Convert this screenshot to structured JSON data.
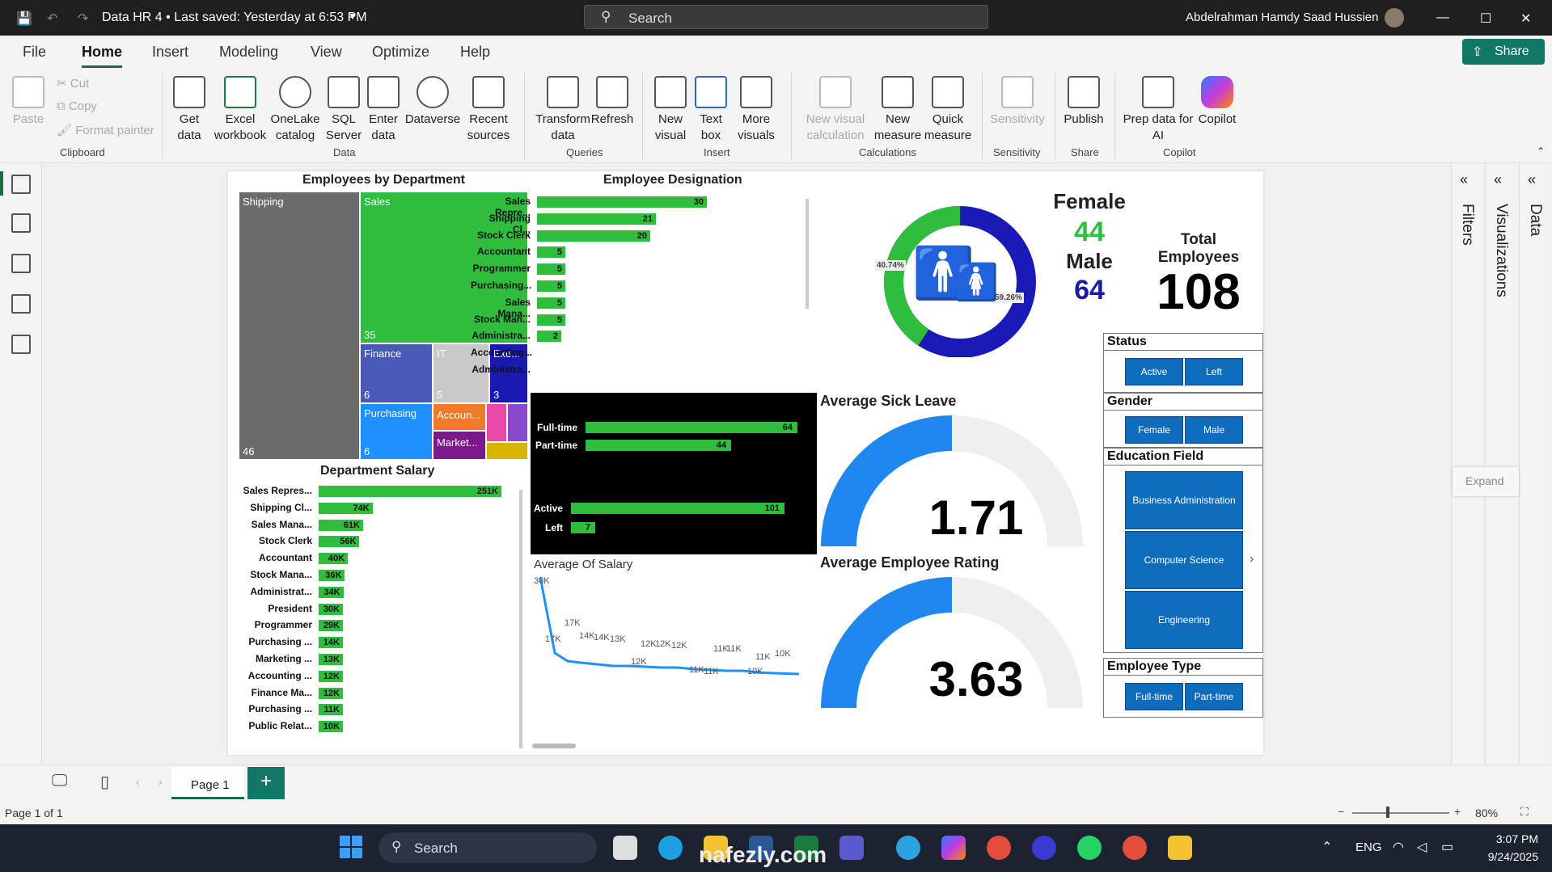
{
  "window": {
    "title": "Data HR 4 • Last saved: Yesterday at 6:53 PM",
    "search_placeholder": "Search",
    "user": "Abdelrahman Hamdy Saad Hussien"
  },
  "menu": {
    "items": [
      "File",
      "Home",
      "Insert",
      "Modeling",
      "View",
      "Optimize",
      "Help"
    ],
    "active": "Home",
    "share_label": "Share"
  },
  "ribbon": {
    "clipboard": {
      "paste": "Paste",
      "cut": "Cut",
      "copy": "Copy",
      "format_painter": "Format painter",
      "group": "Clipboard"
    },
    "data": {
      "group": "Data",
      "buttons": [
        "Get data",
        "Excel workbook",
        "OneLake catalog",
        "SQL Server",
        "Enter data",
        "Dataverse",
        "Recent sources"
      ]
    },
    "queries": {
      "group": "Queries",
      "buttons": [
        "Transform data",
        "Refresh"
      ]
    },
    "insert": {
      "group": "Insert",
      "buttons": [
        "New visual",
        "Text box",
        "More visuals"
      ]
    },
    "calculations": {
      "group": "Calculations",
      "buttons": [
        "New visual calculation",
        "New measure",
        "Quick measure"
      ]
    },
    "sensitivity": {
      "group": "Sensitivity",
      "buttons": [
        "Sensitivity"
      ]
    },
    "share": {
      "group": "Share",
      "buttons": [
        "Publish"
      ]
    },
    "copilot": {
      "group": "Copilot",
      "buttons": [
        "Prep data for AI",
        "Copilot"
      ]
    }
  },
  "panes": {
    "filters": "Filters",
    "visualizations": "Visualizations",
    "data": "Data",
    "expand": "Expand"
  },
  "report": {
    "treemap": {
      "title": "Employees by Department",
      "items": [
        {
          "name": "Shipping",
          "value": "46",
          "color": "#6b6b6b"
        },
        {
          "name": "Sales",
          "value": "35",
          "color": "#2ebd3c"
        },
        {
          "name": "Finance",
          "value": "6",
          "color": "#4a5ab8"
        },
        {
          "name": "IT",
          "value": "5",
          "color": "#c8c8c8"
        },
        {
          "name": "Exe...",
          "value": "3",
          "color": "#1a1ab0"
        },
        {
          "name": "Purchasing",
          "value": "6",
          "color": "#1e90ff"
        },
        {
          "name": "Accoun...",
          "value": "",
          "color": "#f07a2a"
        },
        {
          "name": "Market...",
          "value": "",
          "color": "#7a1a8a"
        }
      ]
    },
    "designation": {
      "title": "Employee Designation",
      "labels": [
        "Sales Repre...",
        "Shipping Cl...",
        "Stock Clerk",
        "Accountant",
        "Programmer",
        "Purchasing...",
        "Sales Mana...",
        "Stock Man...",
        "Administra...",
        "Accounting...",
        "Administra..."
      ],
      "values": [
        "30",
        "21",
        "20",
        "5",
        "5",
        "5",
        "5",
        "5",
        "2",
        "",
        ""
      ],
      "nums": [
        30,
        21,
        20,
        5,
        5,
        5,
        5,
        5,
        2,
        0,
        0
      ]
    },
    "dept_salary": {
      "title": "Department Salary",
      "labels": [
        "Sales Repres...",
        "Shipping Cl...",
        "Sales Mana...",
        "Stock Clerk",
        "Accountant",
        "Stock Mana...",
        "Administrat...",
        "President",
        "Programmer",
        "Purchasing ...",
        "Marketing ...",
        "Accounting ...",
        "Finance Ma...",
        "Purchasing ...",
        "Public Relat..."
      ],
      "values": [
        "251K",
        "74K",
        "61K",
        "56K",
        "40K",
        "36K",
        "34K",
        "30K",
        "29K",
        "14K",
        "13K",
        "12K",
        "12K",
        "11K",
        "10K"
      ],
      "nums": [
        251,
        74,
        61,
        56,
        40,
        36,
        34,
        30,
        29,
        14,
        13,
        12,
        12,
        11,
        10
      ]
    },
    "type_status": {
      "labels": [
        "Full-time",
        "Part-time",
        "Active",
        "Left"
      ],
      "values": [
        "64",
        "44",
        "101",
        "7"
      ],
      "nums": [
        64,
        44,
        101,
        7
      ]
    },
    "gender": {
      "female_label": "Female",
      "female_value": "44",
      "male_label": "Male",
      "male_value": "64",
      "female_pct": "40.74%",
      "male_pct": "59.26%",
      "female_frac": 0.4074
    },
    "total": {
      "label": "Total Employees",
      "value": "108"
    },
    "sick_leave": {
      "title": "Average Sick Leave",
      "value": "1.71",
      "fill": 0.5
    },
    "rating": {
      "title": "Average Employee Rating",
      "value": "3.63",
      "fill": 0.5
    },
    "salary_line": {
      "title": "Average Of Salary",
      "labels": [
        "30K",
        "17K",
        "17K",
        "14K",
        "14K",
        "13K",
        "12K",
        "12K",
        "12K",
        "12K",
        "11K",
        "11K",
        "11K",
        "11K",
        "11K",
        "10K",
        "10K"
      ]
    },
    "slicers": {
      "status": {
        "title": "Status",
        "options": [
          "Active",
          "Left"
        ]
      },
      "gender": {
        "title": "Gender",
        "options": [
          "Female",
          "Male"
        ]
      },
      "education": {
        "title": "Education Field",
        "options": [
          "Business Administration",
          "Computer Science",
          "Engineering"
        ]
      },
      "employee_type": {
        "title": "Employee Type",
        "options": [
          "Full-time",
          "Part-time"
        ]
      }
    }
  },
  "pagetabs": {
    "page": "Page 1",
    "add": "+"
  },
  "status": {
    "page_of": "Page 1 of 1",
    "zoom": "80%"
  },
  "taskbar": {
    "search": "Search",
    "lang": "ENG",
    "time": "3:07 PM",
    "date": "9/24/2025",
    "watermark": "nafezly.com"
  }
}
